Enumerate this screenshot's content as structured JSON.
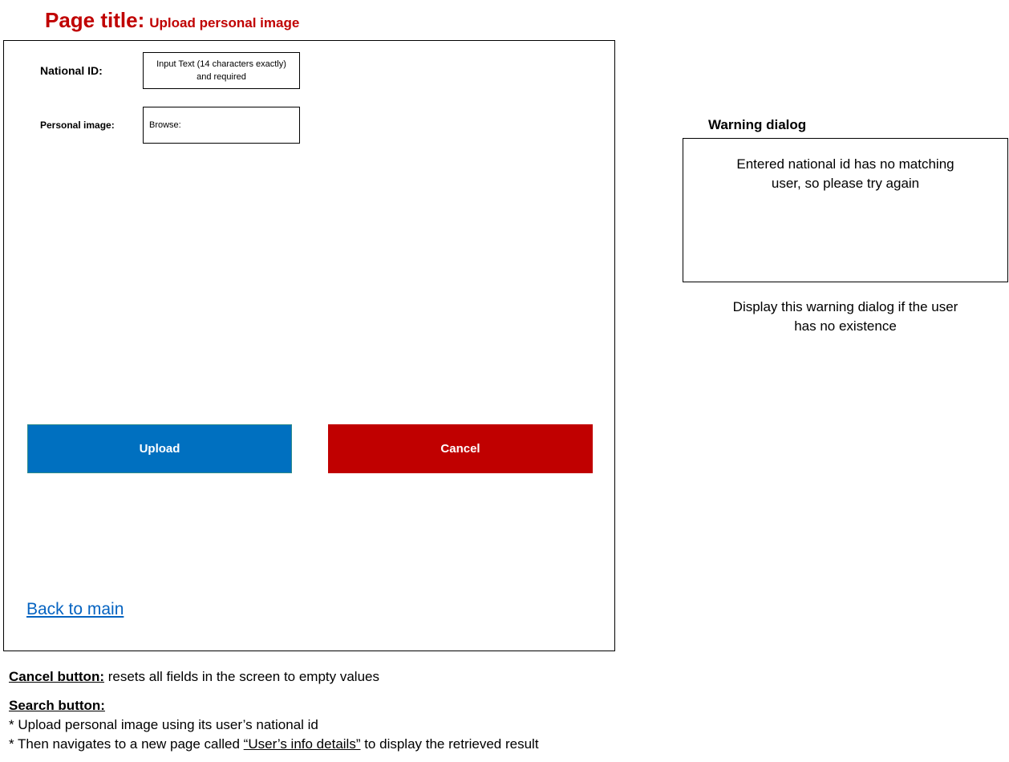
{
  "page_title": {
    "prefix": "Page title:",
    "value": "Upload personal image"
  },
  "form": {
    "national_id": {
      "label": "National ID:",
      "placeholder": "Input Text (14 characters exactly) and required"
    },
    "personal_image": {
      "label": "Personal image:",
      "placeholder": "Browse:"
    },
    "upload_button": "Upload",
    "cancel_button": "Cancel",
    "back_link": "Back to main"
  },
  "warning": {
    "heading": "Warning dialog",
    "message": "Entered national id has no matching user, so please try again",
    "note": "Display this warning dialog if the user has no existence"
  },
  "notes": {
    "cancel_heading": "Cancel button:",
    "cancel_text": " resets all fields in the screen to empty values",
    "search_heading": "Search button:",
    "search_line1": "* Upload personal image using its user’s national id",
    "search_line2_prefix": "* Then navigates to a new page called ",
    "search_line2_link": "“User’s info details”",
    "search_line2_suffix": " to display the retrieved result"
  },
  "colors": {
    "title": "#c00000",
    "upload_button": "#0070c0",
    "cancel_button": "#c00000",
    "link": "#0563c1"
  }
}
